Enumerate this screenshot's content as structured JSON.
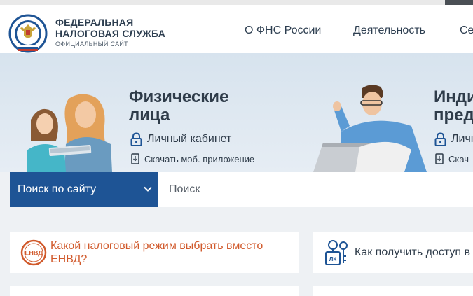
{
  "header": {
    "brand_line1": "ФЕДЕРАЛЬНАЯ",
    "brand_line2": "НАЛОГОВАЯ СЛУЖБА",
    "brand_sub": "ОФИЦИАЛЬНЫЙ САЙТ",
    "nav": [
      "О ФНС России",
      "Деятельность",
      "Се"
    ]
  },
  "hero": {
    "individuals": {
      "title_line1": "Физические",
      "title_line2": "лица",
      "cabinet_label": "Личный кабинет",
      "app_label": "Скачать моб. приложение"
    },
    "entrepreneurs": {
      "title_line1": "Инди",
      "title_line2": "пред",
      "cabinet_label": "Личн",
      "app_label": "Скач"
    }
  },
  "search": {
    "select_label": "Поиск по сайту",
    "placeholder": "Поиск"
  },
  "cards": [
    {
      "text": "Какой налоговый режим выбрать вместо ЕНВД?",
      "icon": "envd-stamp-icon",
      "badge": "ЕНВД"
    },
    {
      "text": "Как получить доступ в",
      "icon": "lk-keys-icon",
      "badge": "ЛК"
    }
  ],
  "colors": {
    "brand_blue": "#1e5495",
    "accent_orange": "#d15a2c",
    "text_dark": "#2f3c4a"
  }
}
